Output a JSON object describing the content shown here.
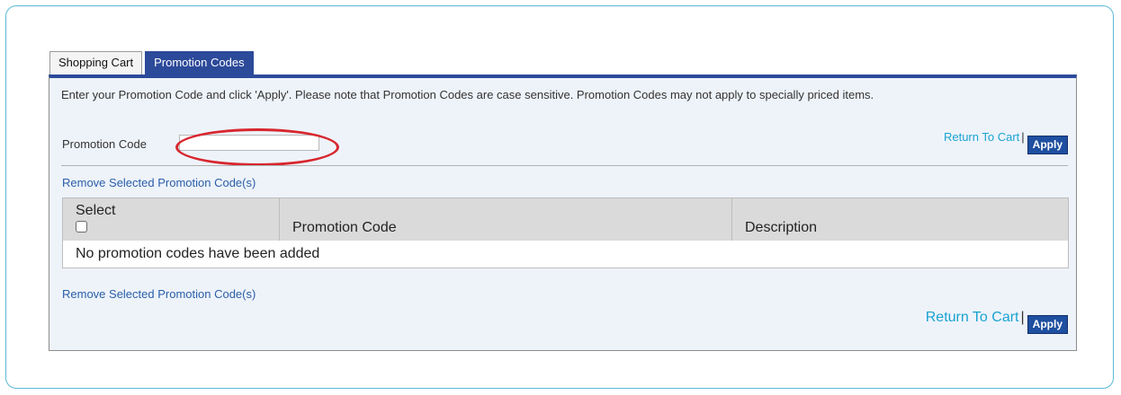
{
  "tabs": [
    {
      "label": "Shopping Cart",
      "active": false
    },
    {
      "label": "Promotion Codes",
      "active": true
    }
  ],
  "panel": {
    "instructions": "Enter your Promotion Code and click 'Apply'. Please note that Promotion Codes are case sensitive. Promotion Codes may not apply to specially priced items.",
    "promo_code_label": "Promotion Code",
    "promo_code_value": "",
    "return_to_cart": "Return To Cart",
    "separator": "|",
    "apply_label": "Apply",
    "remove_selected": "Remove Selected Promotion Code(s)"
  },
  "table": {
    "columns": [
      "Select",
      "Promotion Code",
      "Description"
    ],
    "empty_message": "No promotion codes have been added"
  },
  "colors": {
    "tab_active": "#2c4a9a",
    "apply_button": "#1f4fa0",
    "link": "#1aa3cf",
    "highlight": "#d8262e",
    "frame": "#5ab8d6"
  }
}
